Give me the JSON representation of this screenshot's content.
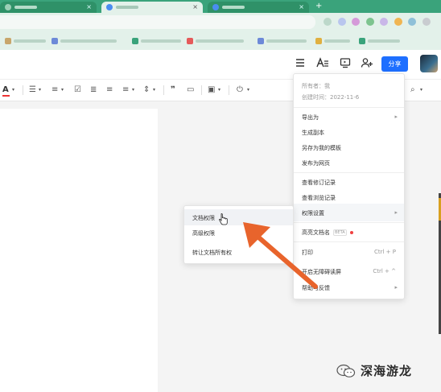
{
  "header": {
    "share_label": "分享",
    "icons": [
      "menu-icon",
      "font-icon",
      "present-icon",
      "add-user-icon"
    ]
  },
  "menu": {
    "owner_line": "所有者：我",
    "created_line": "创建时间：2022-11-6",
    "items": {
      "export_as": "导出为",
      "create_copy": "生成副本",
      "save_template": "另存为我的模板",
      "publish_web": "发布为网页",
      "view_revisions": "查看修订记录",
      "view_browse": "查看浏览记录",
      "permission_settings": "权限设置",
      "doc_name_hl": "高亮文档名",
      "beta": "BETA",
      "print": "打印",
      "print_shortcut": "Ctrl + P",
      "accessible_mode": "开启无障碍读屏",
      "accessible_shortcut": "Ctrl + ^",
      "help_feedback": "帮助与反馈"
    }
  },
  "submenu": {
    "doc_permission": "文档权限",
    "advanced_permission": "高级权限",
    "transfer_owner": "转让文档所有权"
  },
  "watermark": {
    "text": "深海游龙",
    "icon": "wechat-icon"
  },
  "colors": {
    "tabbar": "#3aa37b",
    "share_button": "#1e6fff",
    "annotation_arrow": "#e8642c",
    "font_color_bar": "#e33333"
  }
}
